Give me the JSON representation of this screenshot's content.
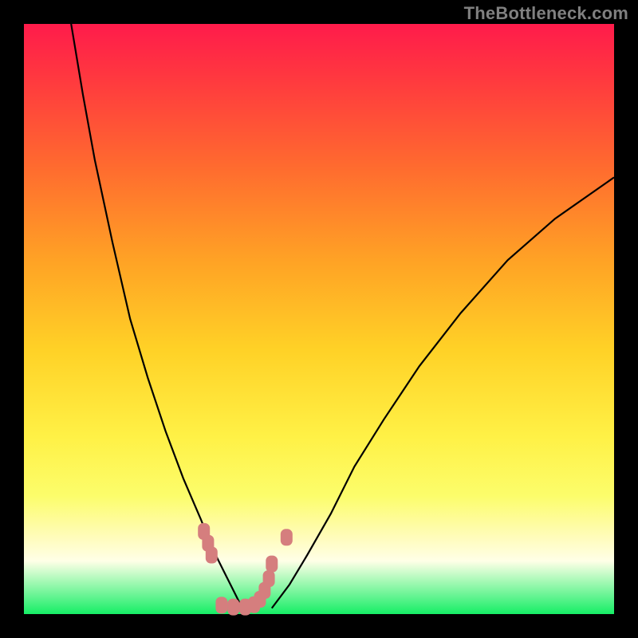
{
  "watermark": "TheBottleneck.com",
  "chart_data": {
    "type": "line",
    "title": "",
    "xlabel": "",
    "ylabel": "",
    "xlim": [
      0,
      100
    ],
    "ylim": [
      0,
      100
    ],
    "series": [
      {
        "name": "left-curve",
        "x": [
          8,
          10,
          12,
          15,
          18,
          21,
          24,
          27,
          30,
          32,
          34,
          35.5,
          37
        ],
        "y": [
          100,
          88,
          77,
          63,
          50,
          40,
          31,
          23,
          16,
          11,
          7,
          4,
          1
        ]
      },
      {
        "name": "right-curve",
        "x": [
          42,
          45,
          48,
          52,
          56,
          61,
          67,
          74,
          82,
          90,
          100
        ],
        "y": [
          1,
          5,
          10,
          17,
          25,
          33,
          42,
          51,
          60,
          67,
          74
        ]
      }
    ],
    "highlight_points": {
      "name": "pink-markers",
      "x": [
        30.5,
        31.2,
        31.8,
        33.5,
        35.5,
        37.5,
        39.0,
        40.0,
        40.8,
        41.5,
        42.0,
        44.5
      ],
      "y": [
        14,
        12,
        10,
        1.5,
        1.2,
        1.2,
        1.6,
        2.5,
        4.0,
        6.0,
        8.5,
        13
      ]
    },
    "background_gradient": {
      "top": "#ff1b4b",
      "mid": "#fff146",
      "bottom": "#16ee66"
    }
  }
}
